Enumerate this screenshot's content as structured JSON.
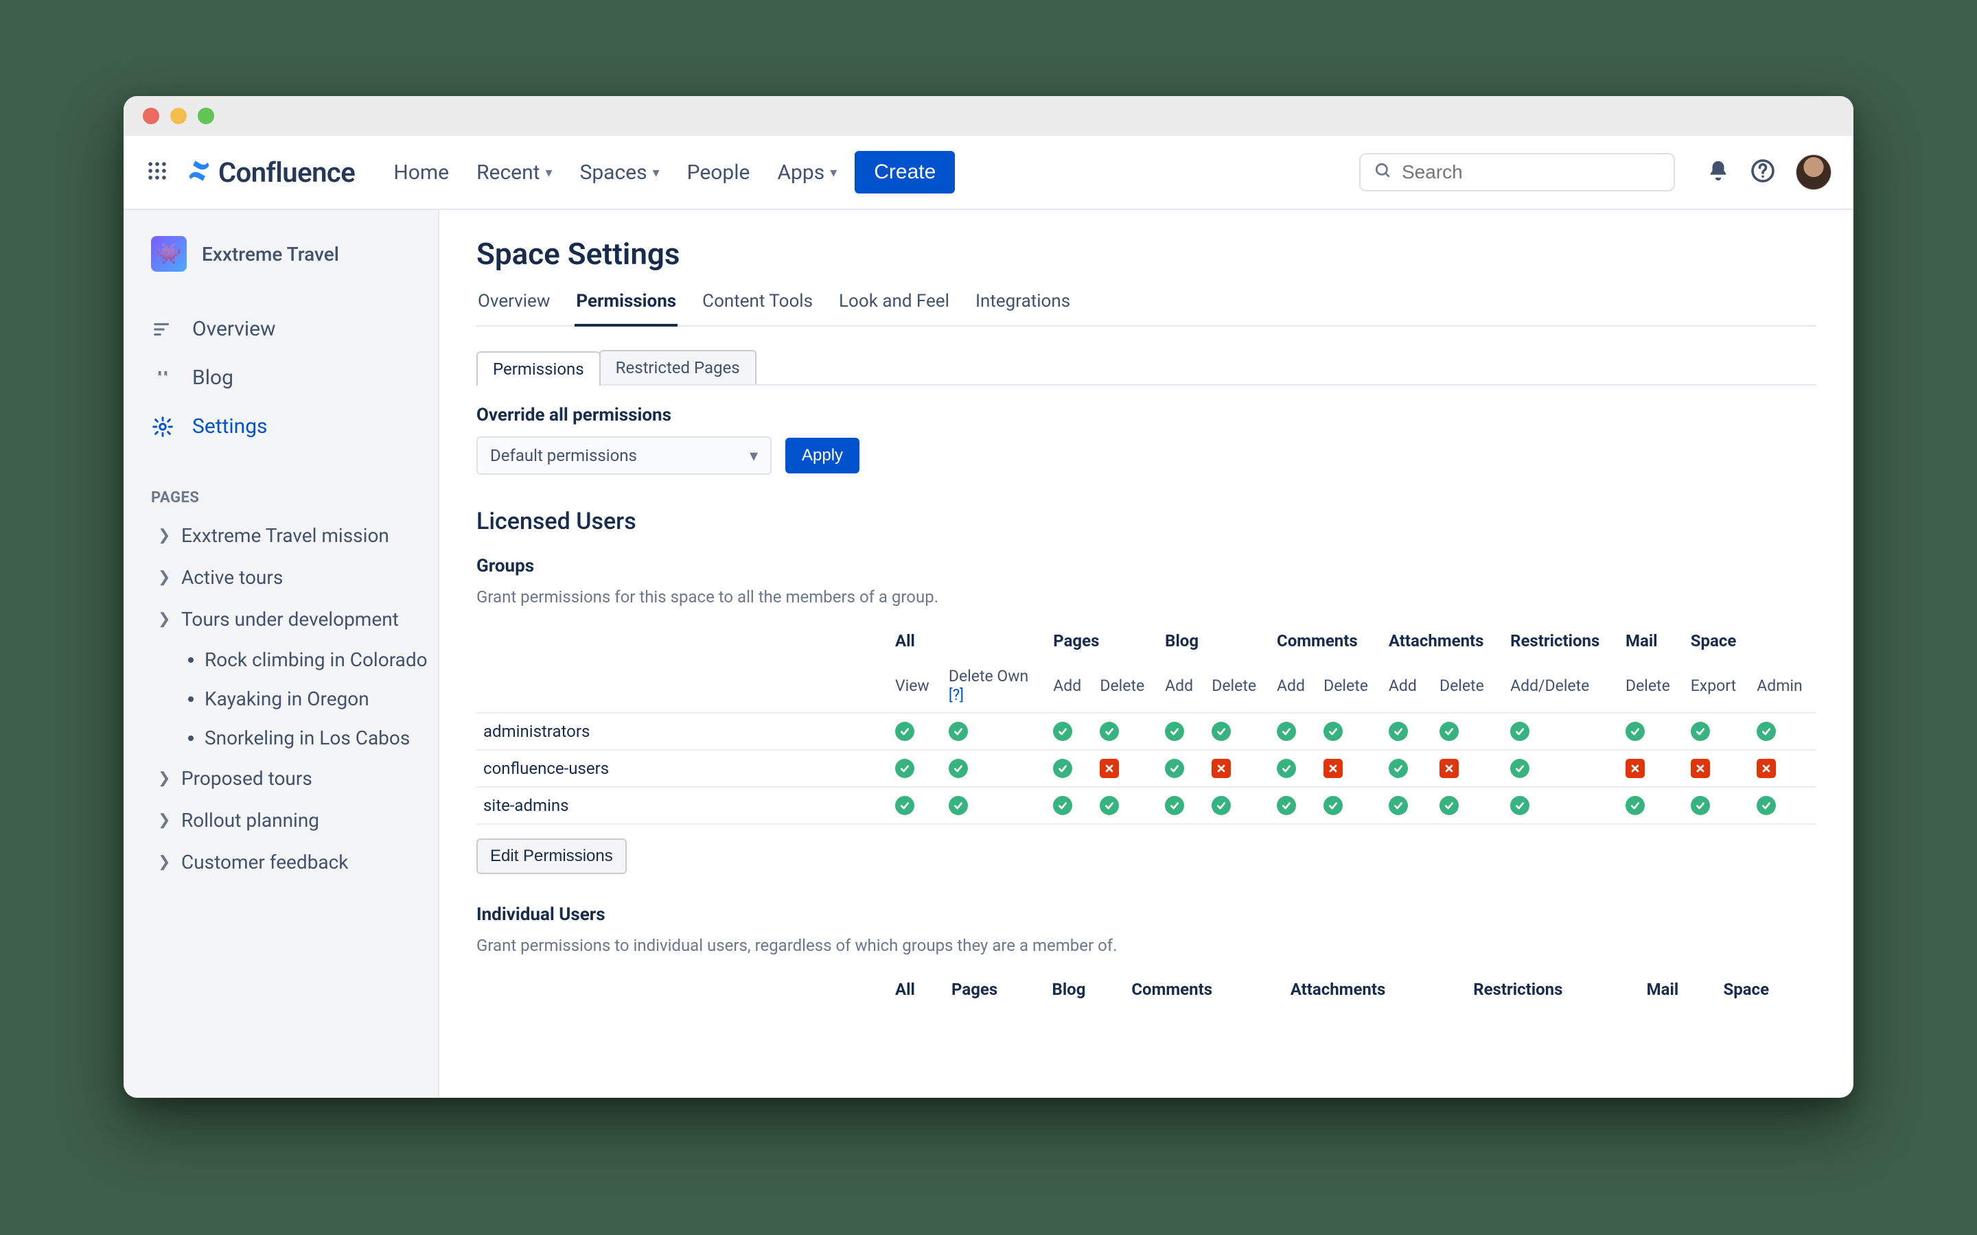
{
  "app": {
    "name": "Confluence"
  },
  "topnav": {
    "links": [
      "Home",
      "Recent",
      "Spaces",
      "People",
      "Apps"
    ],
    "create": "Create",
    "search_placeholder": "Search"
  },
  "sidebar": {
    "space_name": "Exxtreme Travel",
    "items": [
      {
        "icon": "overview",
        "label": "Overview"
      },
      {
        "icon": "blog",
        "label": "Blog"
      },
      {
        "icon": "settings",
        "label": "Settings",
        "active": true
      }
    ],
    "pages_label": "PAGES",
    "pages": [
      {
        "label": "Exxtreme Travel mission"
      },
      {
        "label": "Active tours"
      },
      {
        "label": "Tours under development",
        "children": [
          "Rock climbing in Colorado",
          "Kayaking in Oregon",
          "Snorkeling in Los Cabos"
        ]
      },
      {
        "label": "Proposed tours"
      },
      {
        "label": "Rollout planning"
      },
      {
        "label": "Customer feedback"
      }
    ]
  },
  "main": {
    "title": "Space Settings",
    "tabs": [
      "Overview",
      "Permissions",
      "Content Tools",
      "Look and Feel",
      "Integrations"
    ],
    "active_tab": "Permissions",
    "subtabs": [
      "Permissions",
      "Restricted Pages"
    ],
    "active_subtab": "Permissions",
    "override": {
      "label": "Override all permissions",
      "select_value": "Default permissions",
      "apply": "Apply"
    },
    "licensed_title": "Licensed Users",
    "groups": {
      "title": "Groups",
      "desc": "Grant permissions for this space to all the members of a group.",
      "edit": "Edit Permissions"
    },
    "columns": {
      "group_headers": [
        "All",
        "Pages",
        "Blog",
        "Comments",
        "Attachments",
        "Restrictions",
        "Mail",
        "Space"
      ],
      "sub_headers": [
        "View",
        "Delete Own",
        "Add",
        "Delete",
        "Add",
        "Delete",
        "Add",
        "Delete",
        "Add",
        "Delete",
        "Add/Delete",
        "Delete",
        "Export",
        "Admin"
      ],
      "help": "[?]"
    },
    "rows": [
      {
        "name": "administrators",
        "vals": [
          1,
          1,
          1,
          1,
          1,
          1,
          1,
          1,
          1,
          1,
          1,
          1,
          1,
          1
        ]
      },
      {
        "name": "confluence-users",
        "vals": [
          1,
          1,
          1,
          0,
          1,
          0,
          1,
          0,
          1,
          0,
          1,
          0,
          0,
          0
        ]
      },
      {
        "name": "site-admins",
        "vals": [
          1,
          1,
          1,
          1,
          1,
          1,
          1,
          1,
          1,
          1,
          1,
          1,
          1,
          1
        ]
      }
    ],
    "individual": {
      "title": "Individual Users",
      "desc": "Grant permissions to individual users, regardless of which groups they are a member of."
    }
  }
}
